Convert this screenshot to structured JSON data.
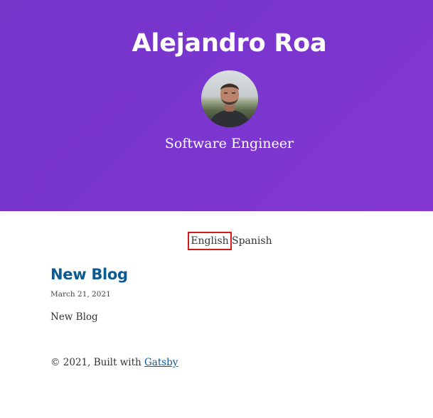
{
  "header": {
    "title": "Alejandro Roa",
    "subtitle": "Software Engineer",
    "avatar_label": "avatar"
  },
  "language_nav": {
    "english": "English",
    "spanish": "Spanish"
  },
  "posts": [
    {
      "title": "New Blog",
      "date": "March 21, 2021",
      "excerpt": "New Blog"
    }
  ],
  "footer": {
    "prefix": "© 2021, Built with ",
    "link_label": "Gatsby"
  },
  "colors": {
    "hero_bg": "#7a36cf",
    "link": "#0b5a92",
    "highlight_border": "#d41a1a"
  }
}
